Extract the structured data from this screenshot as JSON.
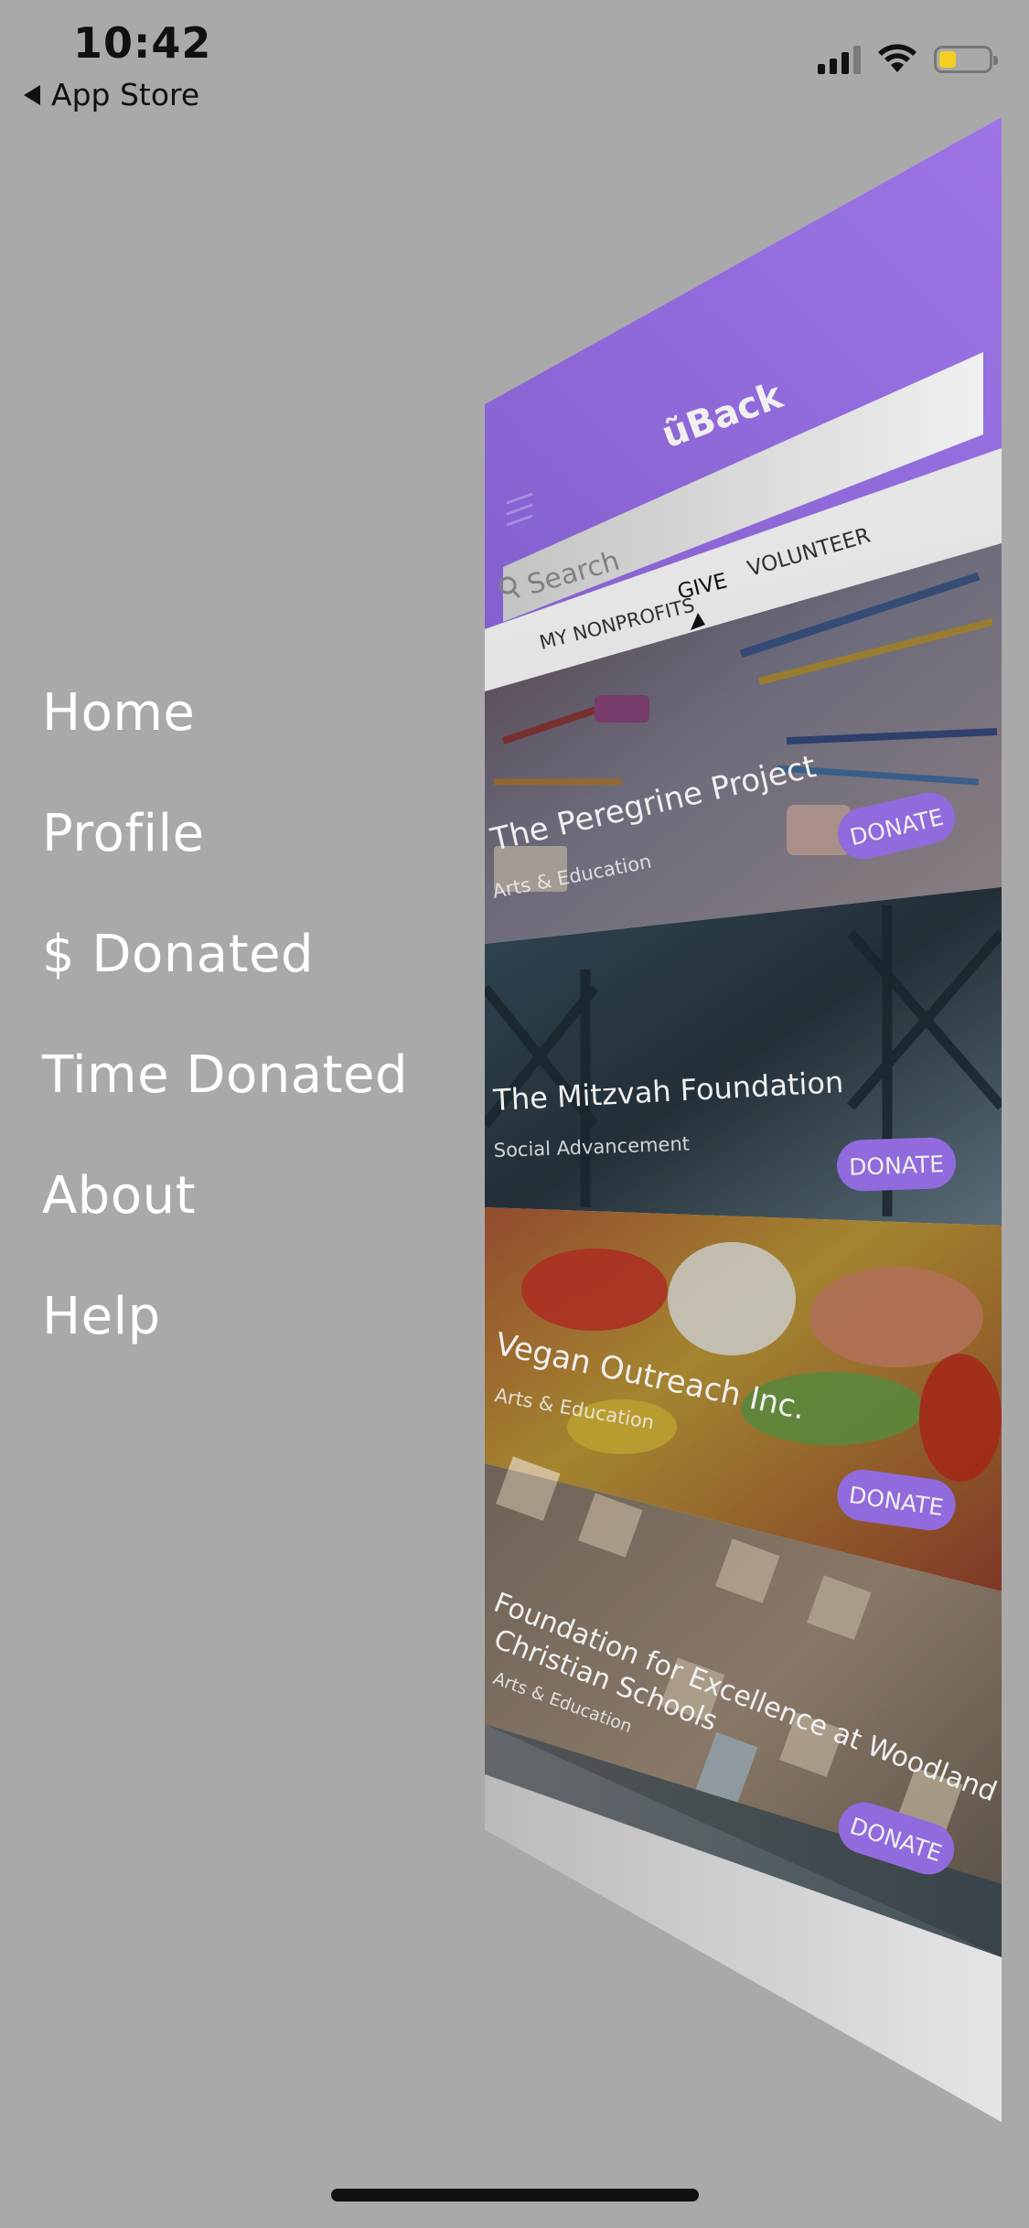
{
  "status_bar": {
    "time": "10:42",
    "back_label": "App Store",
    "battery_level": 0.35,
    "battery_color": "#f4cf22"
  },
  "menu": {
    "items": [
      {
        "label": "Home"
      },
      {
        "label": "Profile"
      },
      {
        "label": "$ Donated"
      },
      {
        "label": "Time Donated"
      },
      {
        "label": "About"
      },
      {
        "label": "Help"
      }
    ]
  },
  "app_preview": {
    "brand_color": "#9b72eb",
    "logo": "ũBack",
    "search_placeholder": "Search",
    "tabs": [
      {
        "label": "MY NONPROFITS"
      },
      {
        "label": "GIVE"
      },
      {
        "label": "VOLUNTEER"
      }
    ],
    "active_tab": "GIVE",
    "donate_label": "DONATE",
    "cards": [
      {
        "name": "The Peregrine Project",
        "category": "Arts & Education"
      },
      {
        "name": "The Mitzvah Foundation",
        "category": "Social Advancement"
      },
      {
        "name": "Vegan Outreach Inc.",
        "category": "Arts & Education"
      },
      {
        "name_lines": [
          "Foundation for Excellence at Woodland",
          "Christian Schools"
        ],
        "category": "Arts & Education"
      }
    ],
    "icons": [
      "hamburger-icon",
      "search-icon",
      "tab-indicator-icon"
    ]
  }
}
